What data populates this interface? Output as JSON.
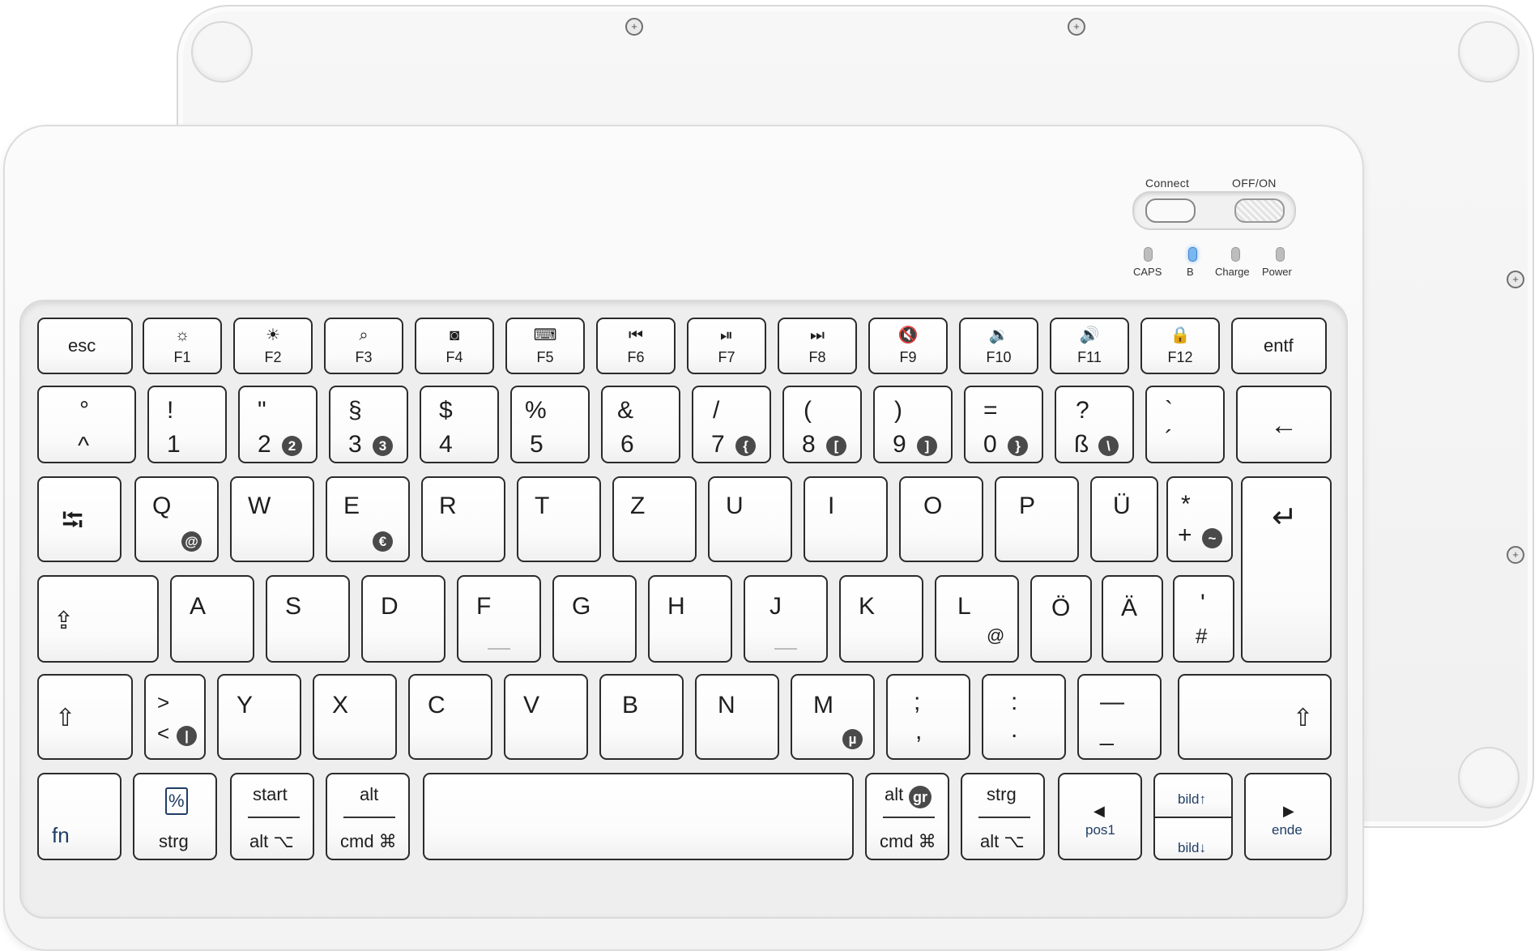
{
  "controls": {
    "connect_label": "Connect",
    "power_label": "OFF/ON",
    "led_labels": [
      "CAPS",
      "B",
      "Charge",
      "Power"
    ]
  },
  "colors": {
    "body": "#f5f5f5",
    "key_border": "#2b2b2b",
    "bluetooth_led": "#7ab6f0"
  },
  "keys": {
    "fn_row": [
      {
        "label": "esc"
      },
      {
        "icon": "☼",
        "label": "F1"
      },
      {
        "icon": "☀",
        "label": "F2"
      },
      {
        "icon": "⌕",
        "label": "F3"
      },
      {
        "icon": "◙",
        "label": "F4"
      },
      {
        "icon": "⌨",
        "label": "F5"
      },
      {
        "icon": "⏮",
        "label": "F6"
      },
      {
        "icon": "⏯",
        "label": "F7"
      },
      {
        "icon": "⏭",
        "label": "F8"
      },
      {
        "icon": "🔇",
        "label": "F9"
      },
      {
        "icon": "🔉",
        "label": "F10"
      },
      {
        "icon": "🔊",
        "label": "F11"
      },
      {
        "icon": "🔒",
        "label": "F12"
      },
      {
        "label": "entf"
      }
    ],
    "num_row": [
      {
        "top": "°",
        "bottom": "^"
      },
      {
        "top": "!",
        "bottom": "1"
      },
      {
        "top": "\"",
        "bottom": "2",
        "alt": "2"
      },
      {
        "top": "§",
        "bottom": "3",
        "alt": "3"
      },
      {
        "top": "$",
        "bottom": "4"
      },
      {
        "top": "%",
        "bottom": "5"
      },
      {
        "top": "&",
        "bottom": "6"
      },
      {
        "top": "/",
        "bottom": "7",
        "alt": "{"
      },
      {
        "top": "(",
        "bottom": "8",
        "alt": "["
      },
      {
        "top": ")",
        "bottom": "9",
        "alt": "]"
      },
      {
        "top": "=",
        "bottom": "0",
        "alt": "}"
      },
      {
        "top": "?",
        "bottom": "ß",
        "alt": "\\"
      },
      {
        "top": "`",
        "bottom": "´"
      },
      {
        "label": "←"
      }
    ],
    "qwertz_row": [
      {
        "label": "⭾"
      },
      {
        "top": "Q",
        "alt": "@"
      },
      {
        "top": "W"
      },
      {
        "top": "E",
        "alt": "€"
      },
      {
        "top": "R"
      },
      {
        "top": "T"
      },
      {
        "top": "Z"
      },
      {
        "top": "U"
      },
      {
        "top": "I"
      },
      {
        "top": "O"
      },
      {
        "top": "P"
      },
      {
        "top": "Ü"
      },
      {
        "top": "*",
        "bottom": "+",
        "alt": "~"
      },
      {
        "label": "↵"
      }
    ],
    "home_row": [
      {
        "label": "⇪"
      },
      {
        "top": "A"
      },
      {
        "top": "S"
      },
      {
        "top": "D"
      },
      {
        "top": "F"
      },
      {
        "top": "G"
      },
      {
        "top": "H"
      },
      {
        "top": "J"
      },
      {
        "top": "K"
      },
      {
        "top": "L",
        "alt": "@"
      },
      {
        "top": "Ö"
      },
      {
        "top": "Ä"
      },
      {
        "top": "'",
        "bottom": "#"
      }
    ],
    "shift_row": [
      {
        "label": "⇧"
      },
      {
        "top": ">",
        "bottom": "<",
        "alt": "|"
      },
      {
        "top": "Y"
      },
      {
        "top": "X"
      },
      {
        "top": "C"
      },
      {
        "top": "V"
      },
      {
        "top": "B"
      },
      {
        "top": "N"
      },
      {
        "top": "M",
        "alt": "µ"
      },
      {
        "top": ";",
        "bottom": ","
      },
      {
        "top": ":",
        "bottom": "."
      },
      {
        "top": "—",
        "bottom": "_"
      },
      {
        "label": "⇧"
      }
    ],
    "bottom_row": [
      {
        "label": "fn"
      },
      {
        "top": "%",
        "bottom": "strg"
      },
      {
        "top": "start",
        "bottom": "alt ⌥"
      },
      {
        "top": "alt",
        "bottom": "cmd ⌘"
      },
      {
        "label": ""
      },
      {
        "top": "alt",
        "alt": "gr",
        "bottom": "cmd ⌘"
      },
      {
        "top": "strg",
        "bottom": "alt ⌥"
      },
      {
        "icon": "◀",
        "label": "pos1"
      },
      {
        "top": "bild↑",
        "bottom": "bild↓"
      },
      {
        "icon": "▶",
        "label": "ende"
      }
    ]
  }
}
